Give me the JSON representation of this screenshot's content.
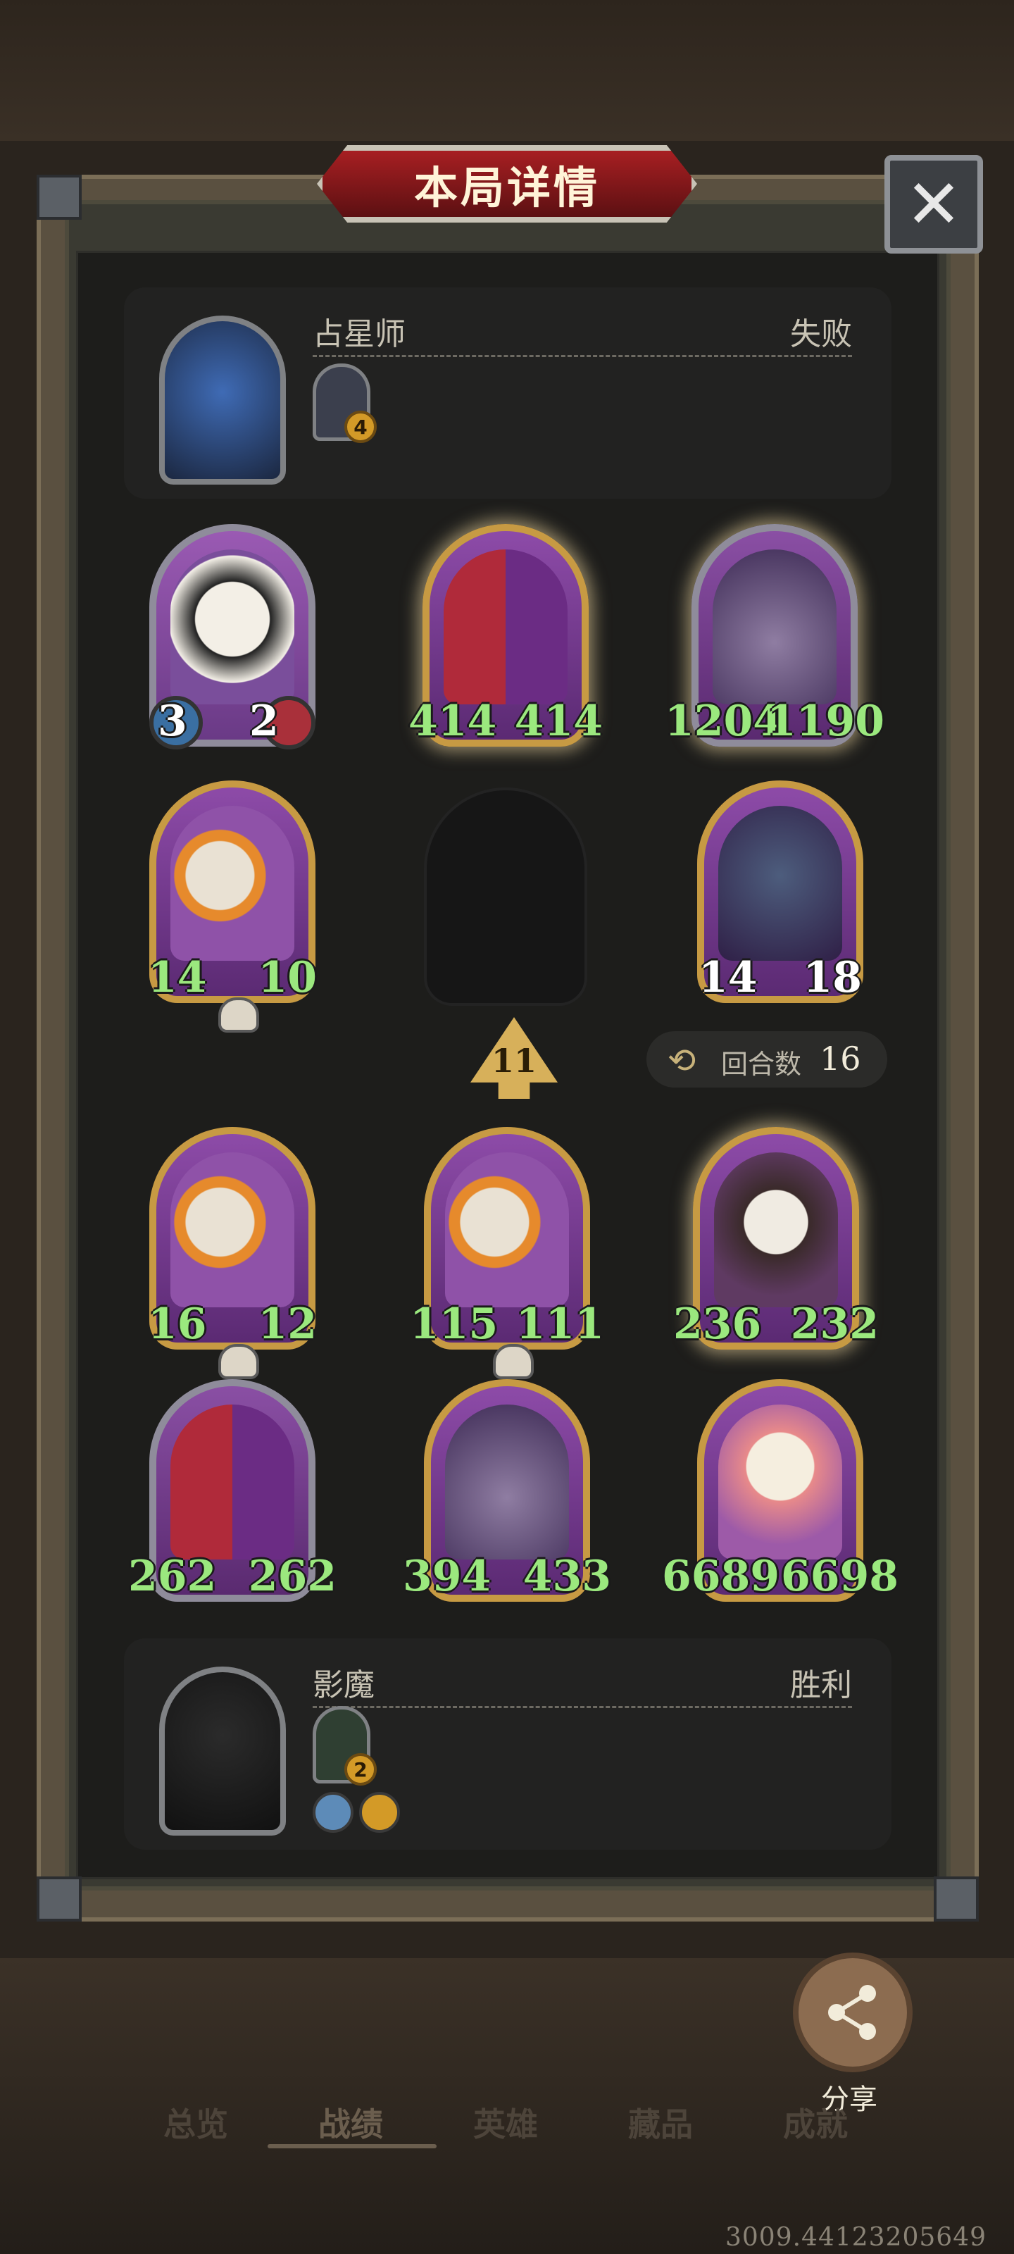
{
  "dialog": {
    "title": "本局详情",
    "close_icon": "close-icon"
  },
  "opponent": {
    "name": "占星师",
    "result": "失败",
    "relic_level": "4",
    "cards": [
      {
        "atk": "3",
        "hp": "2",
        "atk_color": "white",
        "hp_color": "white"
      },
      {
        "atk": "414",
        "hp": "414"
      },
      {
        "atk": "1204",
        "hp": "1190"
      },
      {
        "atk": "14",
        "hp": "10"
      },
      {
        "atk": "14",
        "hp": "18",
        "atk_color": "white",
        "hp_color": "white"
      }
    ]
  },
  "round": {
    "wave": "11",
    "turns_label": "回合数",
    "turns_value": "16"
  },
  "player": {
    "name": "影魔",
    "result": "胜利",
    "relic_level": "2",
    "cards": [
      {
        "atk": "16",
        "hp": "12"
      },
      {
        "atk": "115",
        "hp": "111"
      },
      {
        "atk": "236",
        "hp": "232"
      },
      {
        "atk": "262",
        "hp": "262"
      },
      {
        "atk": "394",
        "hp": "433"
      },
      {
        "atk": "6689",
        "hp": "6698"
      }
    ]
  },
  "share": {
    "label": "分享"
  },
  "tabs": [
    "总览",
    "战绩",
    "英雄",
    "藏品",
    "成就"
  ],
  "active_tab": "战绩",
  "footer_coords": "3009.44123205649",
  "colors": {
    "stat_green": "#9be87e",
    "gold_border": "#c79a43",
    "red_title": "#a71f22"
  }
}
